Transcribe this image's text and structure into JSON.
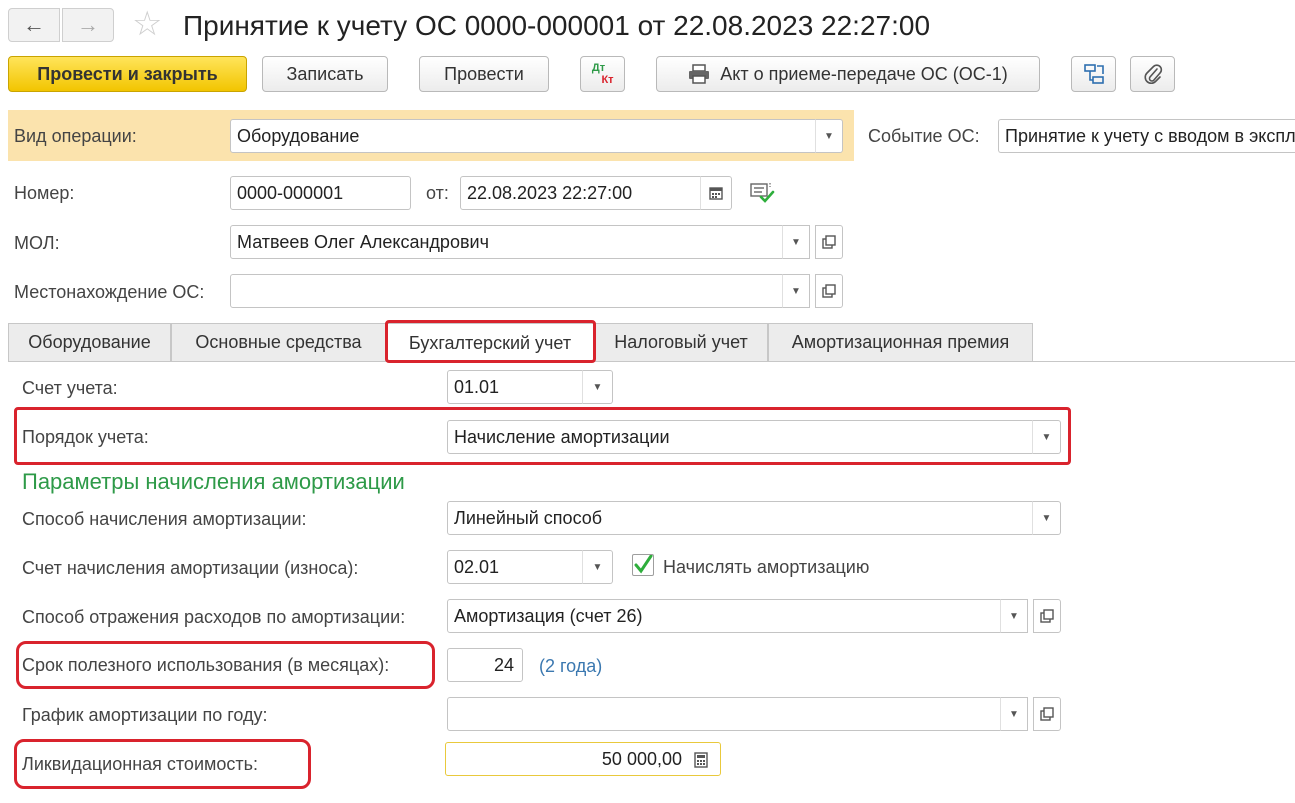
{
  "window": {
    "title": "Принятие к учету ОС 0000-000001 от 22.08.2023 22:27:00",
    "back_icon": "arrow-left-icon",
    "forward_icon": "arrow-right-icon",
    "favorite_icon": "star-icon"
  },
  "toolbar": {
    "post_close": "Провести и закрыть",
    "save": "Записать",
    "post": "Провести",
    "dtkt_dt": "Дт",
    "dtkt_kt": "Кт",
    "print_act": "Акт о приеме-передаче ОС (ОС-1)"
  },
  "header": {
    "operation_label": "Вид операции:",
    "operation_value": "Оборудование",
    "event_label": "Событие ОС:",
    "event_value": "Принятие к учету с вводом в эксплуатацию",
    "number_label": "Номер:",
    "number_value": "0000-000001",
    "date_label": "от:",
    "date_value": "22.08.2023 22:27:00",
    "mol_label": "МОЛ:",
    "mol_value": "Матвеев Олег Александрович",
    "location_label": "Местонахождение ОС:",
    "location_value": ""
  },
  "tabs": [
    {
      "label": "Оборудование"
    },
    {
      "label": "Основные средства"
    },
    {
      "label": "Бухгалтерский учет"
    },
    {
      "label": "Налоговый учет"
    },
    {
      "label": "Амортизационная премия"
    }
  ],
  "accounting": {
    "account_label": "Счет учета:",
    "account_value": "01.01",
    "order_label": "Порядок учета:",
    "order_value": "Начисление амортизации",
    "section_title": "Параметры начисления амортизации",
    "method_label": "Способ начисления амортизации:",
    "method_value": "Линейный способ",
    "depr_account_label": "Счет начисления амортизации (износа):",
    "depr_account_value": "02.01",
    "accrue_label": "Начислять амортизацию",
    "accrue_checked": true,
    "expense_label": "Способ отражения расходов по амортизации:",
    "expense_value": "Амортизация (счет 26)",
    "life_label": "Срок полезного использования (в месяцах):",
    "life_value": "24",
    "life_hint": "(2 года)",
    "schedule_label": "График амортизации по году:",
    "schedule_value": "",
    "salvage_label": "Ликвидационная стоимость:",
    "salvage_value": "50 000,00"
  }
}
